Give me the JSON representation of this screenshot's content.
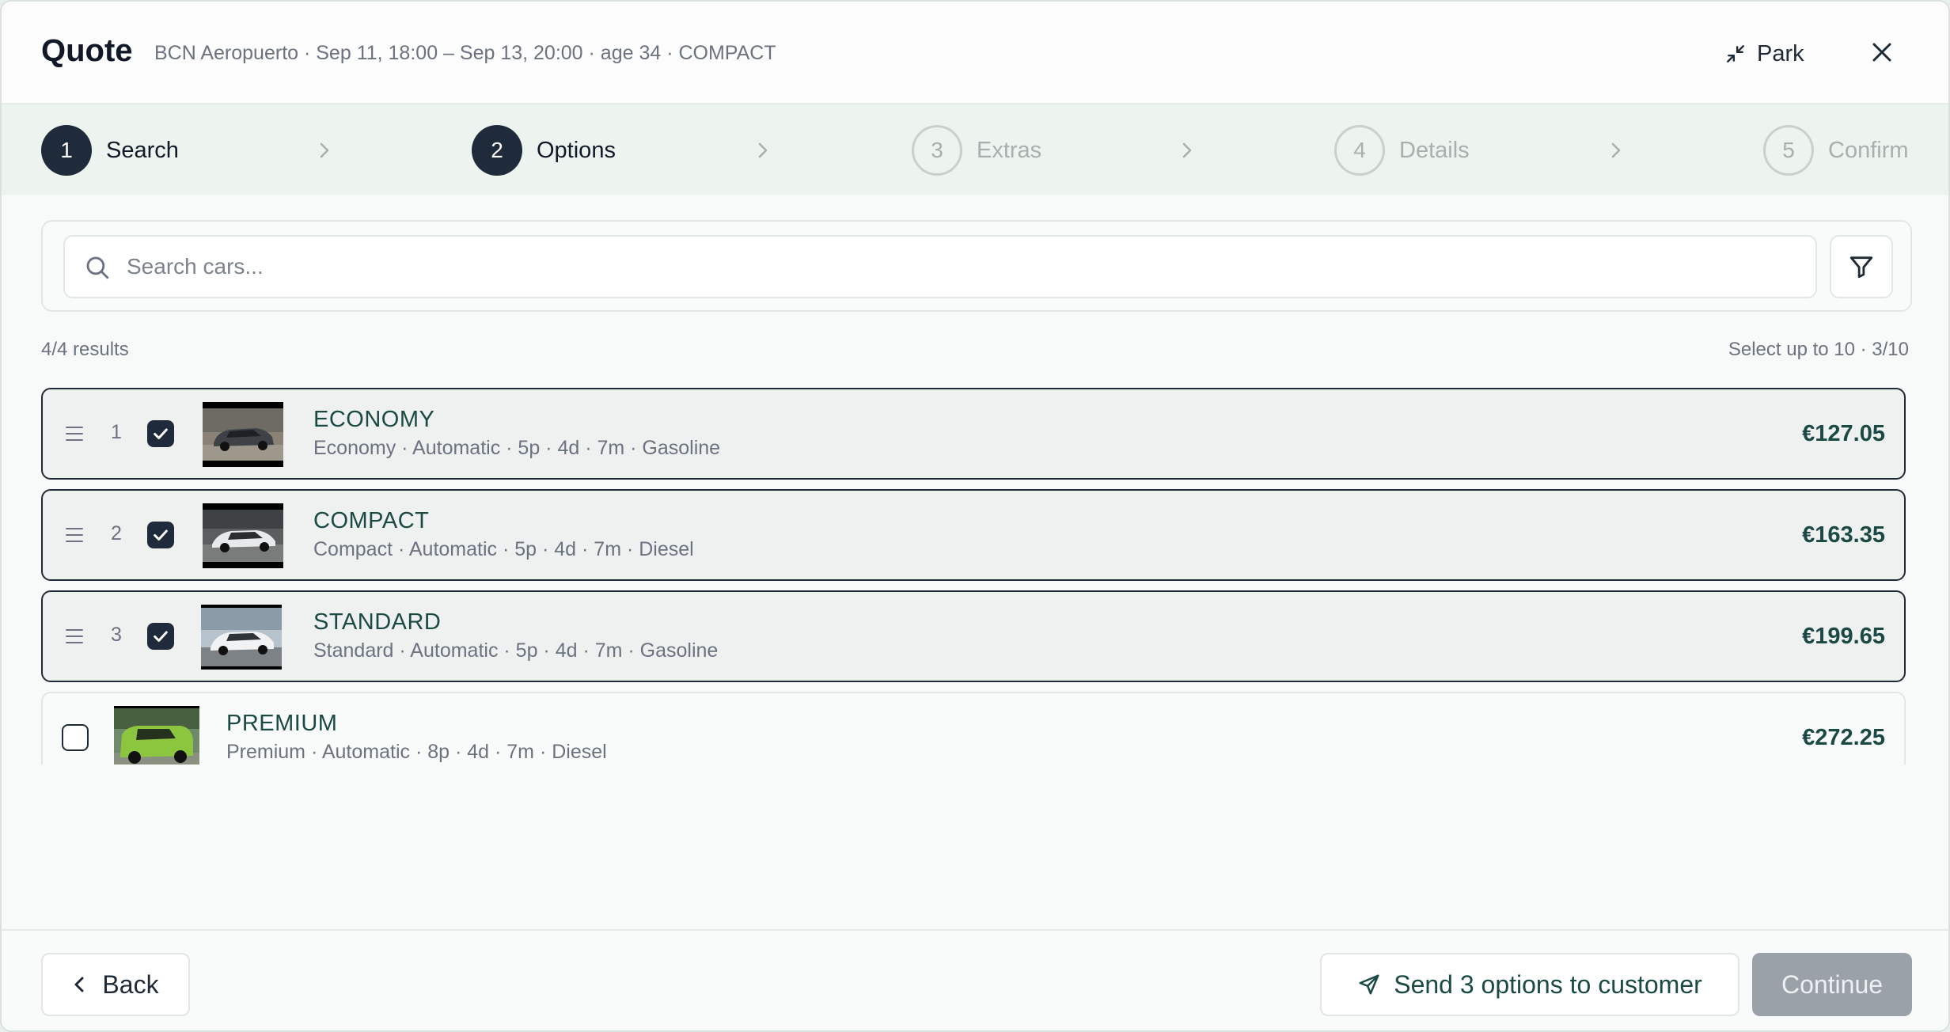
{
  "header": {
    "title": "Quote",
    "subtitle": "BCN Aeropuerto · Sep 11, 18:00 – Sep 13, 20:00 · age 34 · COMPACT",
    "park_label": "Park",
    "park_icon": "minimize-icon",
    "close_icon": "close-icon"
  },
  "stepper": {
    "steps": [
      {
        "num": "1",
        "label": "Search",
        "state": "active"
      },
      {
        "num": "2",
        "label": "Options",
        "state": "active"
      },
      {
        "num": "3",
        "label": "Extras",
        "state": "inactive"
      },
      {
        "num": "4",
        "label": "Details",
        "state": "inactive"
      },
      {
        "num": "5",
        "label": "Confirm",
        "state": "inactive"
      }
    ]
  },
  "search": {
    "placeholder": "Search cars...",
    "value": "",
    "icon": "search-icon",
    "filter_icon": "filter-icon"
  },
  "results": {
    "count_label": "4/4 results",
    "limit_label": "Select up to 10 · 3/10"
  },
  "cars": [
    {
      "rank": "1",
      "selected": true,
      "name": "ECONOMY",
      "meta": "Economy · Automatic · 5p · 4d · 7m · Gasoline",
      "price": "€127.05"
    },
    {
      "rank": "2",
      "selected": true,
      "name": "COMPACT",
      "meta": "Compact · Automatic · 5p · 4d · 7m · Diesel",
      "price": "€163.35"
    },
    {
      "rank": "3",
      "selected": true,
      "name": "STANDARD",
      "meta": "Standard · Automatic · 5p · 4d · 7m · Gasoline",
      "price": "€199.65"
    },
    {
      "rank": "",
      "selected": false,
      "name": "PREMIUM",
      "meta": "Premium · Automatic · 8p · 4d · 7m · Diesel",
      "price": "€272.25"
    }
  ],
  "footer": {
    "back_label": "Back",
    "send_label": "Send 3 options to customer",
    "continue_label": "Continue"
  },
  "colors": {
    "primary_dark": "#1f2a3a",
    "accent_text": "#1b4a44",
    "stepper_bg": "#edf3ef",
    "disabled_button": "#9aa1a8"
  }
}
